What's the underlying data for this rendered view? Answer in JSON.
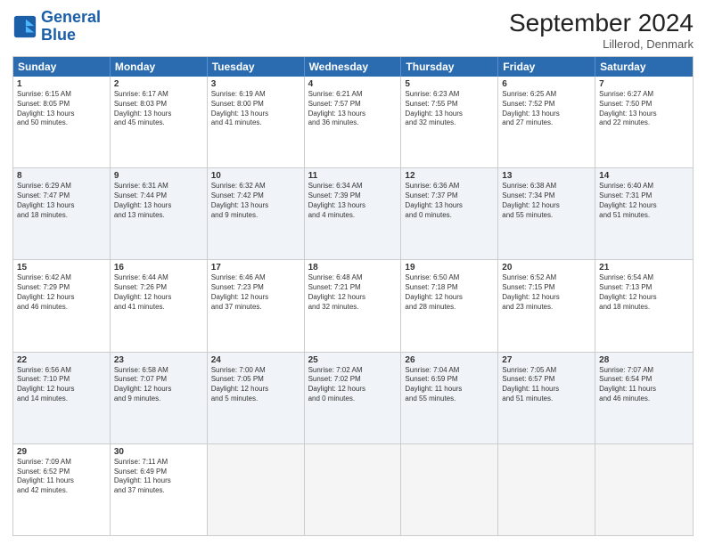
{
  "header": {
    "logo_line1": "General",
    "logo_line2": "Blue",
    "month_year": "September 2024",
    "location": "Lillerod, Denmark"
  },
  "weekdays": [
    "Sunday",
    "Monday",
    "Tuesday",
    "Wednesday",
    "Thursday",
    "Friday",
    "Saturday"
  ],
  "rows": [
    [
      {
        "day": "1",
        "lines": [
          "Sunrise: 6:15 AM",
          "Sunset: 8:05 PM",
          "Daylight: 13 hours",
          "and 50 minutes."
        ]
      },
      {
        "day": "2",
        "lines": [
          "Sunrise: 6:17 AM",
          "Sunset: 8:03 PM",
          "Daylight: 13 hours",
          "and 45 minutes."
        ]
      },
      {
        "day": "3",
        "lines": [
          "Sunrise: 6:19 AM",
          "Sunset: 8:00 PM",
          "Daylight: 13 hours",
          "and 41 minutes."
        ]
      },
      {
        "day": "4",
        "lines": [
          "Sunrise: 6:21 AM",
          "Sunset: 7:57 PM",
          "Daylight: 13 hours",
          "and 36 minutes."
        ]
      },
      {
        "day": "5",
        "lines": [
          "Sunrise: 6:23 AM",
          "Sunset: 7:55 PM",
          "Daylight: 13 hours",
          "and 32 minutes."
        ]
      },
      {
        "day": "6",
        "lines": [
          "Sunrise: 6:25 AM",
          "Sunset: 7:52 PM",
          "Daylight: 13 hours",
          "and 27 minutes."
        ]
      },
      {
        "day": "7",
        "lines": [
          "Sunrise: 6:27 AM",
          "Sunset: 7:50 PM",
          "Daylight: 13 hours",
          "and 22 minutes."
        ]
      }
    ],
    [
      {
        "day": "8",
        "lines": [
          "Sunrise: 6:29 AM",
          "Sunset: 7:47 PM",
          "Daylight: 13 hours",
          "and 18 minutes."
        ]
      },
      {
        "day": "9",
        "lines": [
          "Sunrise: 6:31 AM",
          "Sunset: 7:44 PM",
          "Daylight: 13 hours",
          "and 13 minutes."
        ]
      },
      {
        "day": "10",
        "lines": [
          "Sunrise: 6:32 AM",
          "Sunset: 7:42 PM",
          "Daylight: 13 hours",
          "and 9 minutes."
        ]
      },
      {
        "day": "11",
        "lines": [
          "Sunrise: 6:34 AM",
          "Sunset: 7:39 PM",
          "Daylight: 13 hours",
          "and 4 minutes."
        ]
      },
      {
        "day": "12",
        "lines": [
          "Sunrise: 6:36 AM",
          "Sunset: 7:37 PM",
          "Daylight: 13 hours",
          "and 0 minutes."
        ]
      },
      {
        "day": "13",
        "lines": [
          "Sunrise: 6:38 AM",
          "Sunset: 7:34 PM",
          "Daylight: 12 hours",
          "and 55 minutes."
        ]
      },
      {
        "day": "14",
        "lines": [
          "Sunrise: 6:40 AM",
          "Sunset: 7:31 PM",
          "Daylight: 12 hours",
          "and 51 minutes."
        ]
      }
    ],
    [
      {
        "day": "15",
        "lines": [
          "Sunrise: 6:42 AM",
          "Sunset: 7:29 PM",
          "Daylight: 12 hours",
          "and 46 minutes."
        ]
      },
      {
        "day": "16",
        "lines": [
          "Sunrise: 6:44 AM",
          "Sunset: 7:26 PM",
          "Daylight: 12 hours",
          "and 41 minutes."
        ]
      },
      {
        "day": "17",
        "lines": [
          "Sunrise: 6:46 AM",
          "Sunset: 7:23 PM",
          "Daylight: 12 hours",
          "and 37 minutes."
        ]
      },
      {
        "day": "18",
        "lines": [
          "Sunrise: 6:48 AM",
          "Sunset: 7:21 PM",
          "Daylight: 12 hours",
          "and 32 minutes."
        ]
      },
      {
        "day": "19",
        "lines": [
          "Sunrise: 6:50 AM",
          "Sunset: 7:18 PM",
          "Daylight: 12 hours",
          "and 28 minutes."
        ]
      },
      {
        "day": "20",
        "lines": [
          "Sunrise: 6:52 AM",
          "Sunset: 7:15 PM",
          "Daylight: 12 hours",
          "and 23 minutes."
        ]
      },
      {
        "day": "21",
        "lines": [
          "Sunrise: 6:54 AM",
          "Sunset: 7:13 PM",
          "Daylight: 12 hours",
          "and 18 minutes."
        ]
      }
    ],
    [
      {
        "day": "22",
        "lines": [
          "Sunrise: 6:56 AM",
          "Sunset: 7:10 PM",
          "Daylight: 12 hours",
          "and 14 minutes."
        ]
      },
      {
        "day": "23",
        "lines": [
          "Sunrise: 6:58 AM",
          "Sunset: 7:07 PM",
          "Daylight: 12 hours",
          "and 9 minutes."
        ]
      },
      {
        "day": "24",
        "lines": [
          "Sunrise: 7:00 AM",
          "Sunset: 7:05 PM",
          "Daylight: 12 hours",
          "and 5 minutes."
        ]
      },
      {
        "day": "25",
        "lines": [
          "Sunrise: 7:02 AM",
          "Sunset: 7:02 PM",
          "Daylight: 12 hours",
          "and 0 minutes."
        ]
      },
      {
        "day": "26",
        "lines": [
          "Sunrise: 7:04 AM",
          "Sunset: 6:59 PM",
          "Daylight: 11 hours",
          "and 55 minutes."
        ]
      },
      {
        "day": "27",
        "lines": [
          "Sunrise: 7:05 AM",
          "Sunset: 6:57 PM",
          "Daylight: 11 hours",
          "and 51 minutes."
        ]
      },
      {
        "day": "28",
        "lines": [
          "Sunrise: 7:07 AM",
          "Sunset: 6:54 PM",
          "Daylight: 11 hours",
          "and 46 minutes."
        ]
      }
    ],
    [
      {
        "day": "29",
        "lines": [
          "Sunrise: 7:09 AM",
          "Sunset: 6:52 PM",
          "Daylight: 11 hours",
          "and 42 minutes."
        ]
      },
      {
        "day": "30",
        "lines": [
          "Sunrise: 7:11 AM",
          "Sunset: 6:49 PM",
          "Daylight: 11 hours",
          "and 37 minutes."
        ]
      },
      {
        "day": "",
        "lines": []
      },
      {
        "day": "",
        "lines": []
      },
      {
        "day": "",
        "lines": []
      },
      {
        "day": "",
        "lines": []
      },
      {
        "day": "",
        "lines": []
      }
    ]
  ],
  "alt_rows": [
    1,
    3
  ]
}
